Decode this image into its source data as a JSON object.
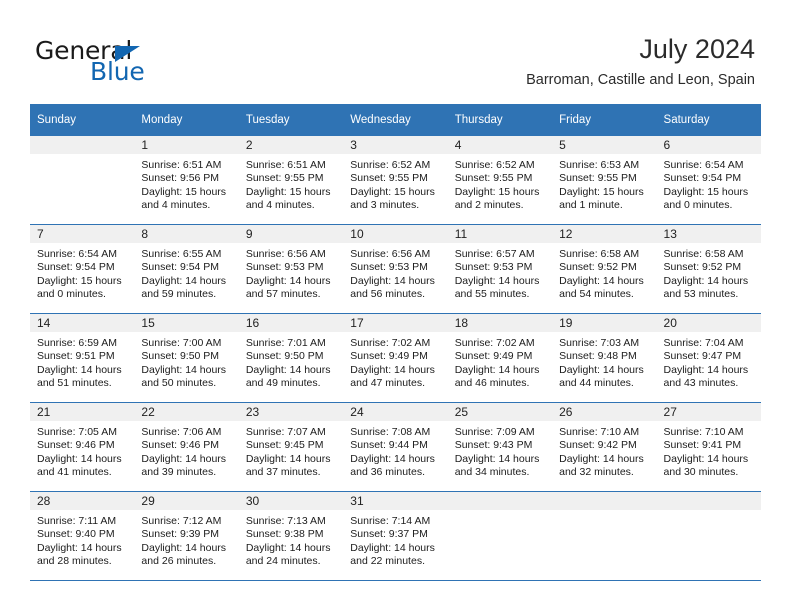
{
  "brand": {
    "name_part1": "General",
    "name_part2": "Blue",
    "accent_color": "#1266b1"
  },
  "header": {
    "title": "July 2024",
    "location": "Barroman, Castille and Leon, Spain"
  },
  "calendar": {
    "header_bg": "#2f73b4",
    "daynum_bg": "#f0f0f0",
    "weekday_headers": [
      "Sunday",
      "Monday",
      "Tuesday",
      "Wednesday",
      "Thursday",
      "Friday",
      "Saturday"
    ],
    "weeks": [
      [
        {
          "day": "",
          "sunrise": "",
          "sunset": "",
          "daylight1": "",
          "daylight2": ""
        },
        {
          "day": "1",
          "sunrise": "Sunrise: 6:51 AM",
          "sunset": "Sunset: 9:56 PM",
          "daylight1": "Daylight: 15 hours",
          "daylight2": "and 4 minutes."
        },
        {
          "day": "2",
          "sunrise": "Sunrise: 6:51 AM",
          "sunset": "Sunset: 9:55 PM",
          "daylight1": "Daylight: 15 hours",
          "daylight2": "and 4 minutes."
        },
        {
          "day": "3",
          "sunrise": "Sunrise: 6:52 AM",
          "sunset": "Sunset: 9:55 PM",
          "daylight1": "Daylight: 15 hours",
          "daylight2": "and 3 minutes."
        },
        {
          "day": "4",
          "sunrise": "Sunrise: 6:52 AM",
          "sunset": "Sunset: 9:55 PM",
          "daylight1": "Daylight: 15 hours",
          "daylight2": "and 2 minutes."
        },
        {
          "day": "5",
          "sunrise": "Sunrise: 6:53 AM",
          "sunset": "Sunset: 9:55 PM",
          "daylight1": "Daylight: 15 hours",
          "daylight2": "and 1 minute."
        },
        {
          "day": "6",
          "sunrise": "Sunrise: 6:54 AM",
          "sunset": "Sunset: 9:54 PM",
          "daylight1": "Daylight: 15 hours",
          "daylight2": "and 0 minutes."
        }
      ],
      [
        {
          "day": "7",
          "sunrise": "Sunrise: 6:54 AM",
          "sunset": "Sunset: 9:54 PM",
          "daylight1": "Daylight: 15 hours",
          "daylight2": "and 0 minutes."
        },
        {
          "day": "8",
          "sunrise": "Sunrise: 6:55 AM",
          "sunset": "Sunset: 9:54 PM",
          "daylight1": "Daylight: 14 hours",
          "daylight2": "and 59 minutes."
        },
        {
          "day": "9",
          "sunrise": "Sunrise: 6:56 AM",
          "sunset": "Sunset: 9:53 PM",
          "daylight1": "Daylight: 14 hours",
          "daylight2": "and 57 minutes."
        },
        {
          "day": "10",
          "sunrise": "Sunrise: 6:56 AM",
          "sunset": "Sunset: 9:53 PM",
          "daylight1": "Daylight: 14 hours",
          "daylight2": "and 56 minutes."
        },
        {
          "day": "11",
          "sunrise": "Sunrise: 6:57 AM",
          "sunset": "Sunset: 9:53 PM",
          "daylight1": "Daylight: 14 hours",
          "daylight2": "and 55 minutes."
        },
        {
          "day": "12",
          "sunrise": "Sunrise: 6:58 AM",
          "sunset": "Sunset: 9:52 PM",
          "daylight1": "Daylight: 14 hours",
          "daylight2": "and 54 minutes."
        },
        {
          "day": "13",
          "sunrise": "Sunrise: 6:58 AM",
          "sunset": "Sunset: 9:52 PM",
          "daylight1": "Daylight: 14 hours",
          "daylight2": "and 53 minutes."
        }
      ],
      [
        {
          "day": "14",
          "sunrise": "Sunrise: 6:59 AM",
          "sunset": "Sunset: 9:51 PM",
          "daylight1": "Daylight: 14 hours",
          "daylight2": "and 51 minutes."
        },
        {
          "day": "15",
          "sunrise": "Sunrise: 7:00 AM",
          "sunset": "Sunset: 9:50 PM",
          "daylight1": "Daylight: 14 hours",
          "daylight2": "and 50 minutes."
        },
        {
          "day": "16",
          "sunrise": "Sunrise: 7:01 AM",
          "sunset": "Sunset: 9:50 PM",
          "daylight1": "Daylight: 14 hours",
          "daylight2": "and 49 minutes."
        },
        {
          "day": "17",
          "sunrise": "Sunrise: 7:02 AM",
          "sunset": "Sunset: 9:49 PM",
          "daylight1": "Daylight: 14 hours",
          "daylight2": "and 47 minutes."
        },
        {
          "day": "18",
          "sunrise": "Sunrise: 7:02 AM",
          "sunset": "Sunset: 9:49 PM",
          "daylight1": "Daylight: 14 hours",
          "daylight2": "and 46 minutes."
        },
        {
          "day": "19",
          "sunrise": "Sunrise: 7:03 AM",
          "sunset": "Sunset: 9:48 PM",
          "daylight1": "Daylight: 14 hours",
          "daylight2": "and 44 minutes."
        },
        {
          "day": "20",
          "sunrise": "Sunrise: 7:04 AM",
          "sunset": "Sunset: 9:47 PM",
          "daylight1": "Daylight: 14 hours",
          "daylight2": "and 43 minutes."
        }
      ],
      [
        {
          "day": "21",
          "sunrise": "Sunrise: 7:05 AM",
          "sunset": "Sunset: 9:46 PM",
          "daylight1": "Daylight: 14 hours",
          "daylight2": "and 41 minutes."
        },
        {
          "day": "22",
          "sunrise": "Sunrise: 7:06 AM",
          "sunset": "Sunset: 9:46 PM",
          "daylight1": "Daylight: 14 hours",
          "daylight2": "and 39 minutes."
        },
        {
          "day": "23",
          "sunrise": "Sunrise: 7:07 AM",
          "sunset": "Sunset: 9:45 PM",
          "daylight1": "Daylight: 14 hours",
          "daylight2": "and 37 minutes."
        },
        {
          "day": "24",
          "sunrise": "Sunrise: 7:08 AM",
          "sunset": "Sunset: 9:44 PM",
          "daylight1": "Daylight: 14 hours",
          "daylight2": "and 36 minutes."
        },
        {
          "day": "25",
          "sunrise": "Sunrise: 7:09 AM",
          "sunset": "Sunset: 9:43 PM",
          "daylight1": "Daylight: 14 hours",
          "daylight2": "and 34 minutes."
        },
        {
          "day": "26",
          "sunrise": "Sunrise: 7:10 AM",
          "sunset": "Sunset: 9:42 PM",
          "daylight1": "Daylight: 14 hours",
          "daylight2": "and 32 minutes."
        },
        {
          "day": "27",
          "sunrise": "Sunrise: 7:10 AM",
          "sunset": "Sunset: 9:41 PM",
          "daylight1": "Daylight: 14 hours",
          "daylight2": "and 30 minutes."
        }
      ],
      [
        {
          "day": "28",
          "sunrise": "Sunrise: 7:11 AM",
          "sunset": "Sunset: 9:40 PM",
          "daylight1": "Daylight: 14 hours",
          "daylight2": "and 28 minutes."
        },
        {
          "day": "29",
          "sunrise": "Sunrise: 7:12 AM",
          "sunset": "Sunset: 9:39 PM",
          "daylight1": "Daylight: 14 hours",
          "daylight2": "and 26 minutes."
        },
        {
          "day": "30",
          "sunrise": "Sunrise: 7:13 AM",
          "sunset": "Sunset: 9:38 PM",
          "daylight1": "Daylight: 14 hours",
          "daylight2": "and 24 minutes."
        },
        {
          "day": "31",
          "sunrise": "Sunrise: 7:14 AM",
          "sunset": "Sunset: 9:37 PM",
          "daylight1": "Daylight: 14 hours",
          "daylight2": "and 22 minutes."
        },
        {
          "day": "",
          "sunrise": "",
          "sunset": "",
          "daylight1": "",
          "daylight2": ""
        },
        {
          "day": "",
          "sunrise": "",
          "sunset": "",
          "daylight1": "",
          "daylight2": ""
        },
        {
          "day": "",
          "sunrise": "",
          "sunset": "",
          "daylight1": "",
          "daylight2": ""
        }
      ]
    ]
  }
}
